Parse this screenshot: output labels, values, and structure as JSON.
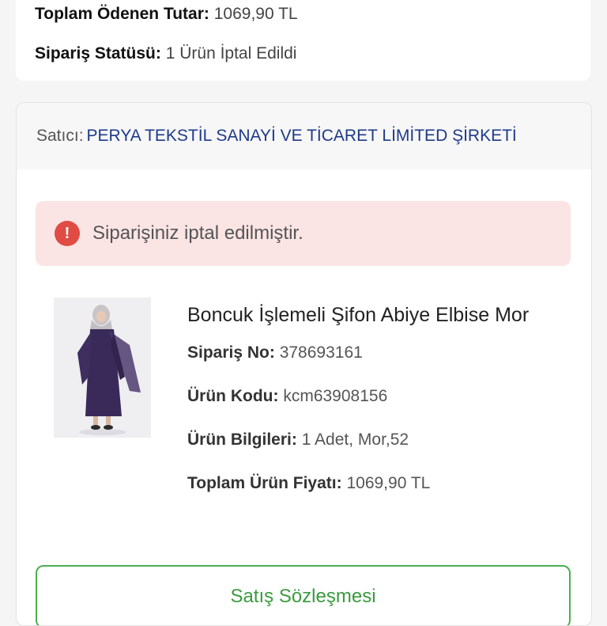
{
  "order_summary": {
    "total_paid_label": "Toplam Ödenen Tutar:",
    "total_paid_value": "1069,90 TL",
    "status_label": "Sipariş Statüsü:",
    "status_value": "1 Ürün İptal Edildi"
  },
  "seller": {
    "prefix": "Satıcı:",
    "name": "PERYA TEKSTİL SANAYİ VE TİCARET LİMİTED ŞİRKETİ"
  },
  "alert": {
    "icon": "exclamation-icon",
    "icon_glyph": "!",
    "message": "Siparişiniz iptal edilmiştir.",
    "color": "#e04b43"
  },
  "product": {
    "title": "Boncuk İşlemeli Şifon Abiye Elbise Mor",
    "order_no_label": "Sipariş No:",
    "order_no_value": "378693161",
    "code_label": "Ürün Kodu:",
    "code_value": "kcm63908156",
    "info_label": "Ürün Bilgileri:",
    "info_value": "1 Adet, Mor,52",
    "price_label": "Toplam Ürün Fiyatı:",
    "price_value": "1069,90 TL"
  },
  "actions": {
    "contract_label": "Satış Sözleşmesi",
    "accent": "#4caf50"
  }
}
